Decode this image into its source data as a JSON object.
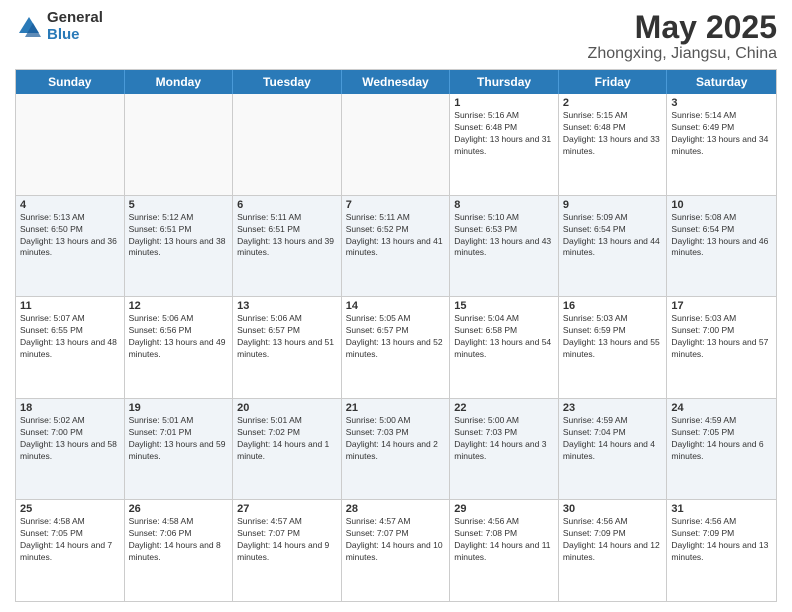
{
  "header": {
    "logo_general": "General",
    "logo_blue": "Blue",
    "title": "May 2025",
    "subtitle": "Zhongxing, Jiangsu, China"
  },
  "calendar": {
    "days": [
      "Sunday",
      "Monday",
      "Tuesday",
      "Wednesday",
      "Thursday",
      "Friday",
      "Saturday"
    ],
    "rows": [
      [
        {
          "num": "",
          "info": "",
          "empty": true
        },
        {
          "num": "",
          "info": "",
          "empty": true
        },
        {
          "num": "",
          "info": "",
          "empty": true
        },
        {
          "num": "",
          "info": "",
          "empty": true
        },
        {
          "num": "1",
          "info": "Sunrise: 5:16 AM\nSunset: 6:48 PM\nDaylight: 13 hours and 31 minutes."
        },
        {
          "num": "2",
          "info": "Sunrise: 5:15 AM\nSunset: 6:48 PM\nDaylight: 13 hours and 33 minutes."
        },
        {
          "num": "3",
          "info": "Sunrise: 5:14 AM\nSunset: 6:49 PM\nDaylight: 13 hours and 34 minutes."
        }
      ],
      [
        {
          "num": "4",
          "info": "Sunrise: 5:13 AM\nSunset: 6:50 PM\nDaylight: 13 hours and 36 minutes."
        },
        {
          "num": "5",
          "info": "Sunrise: 5:12 AM\nSunset: 6:51 PM\nDaylight: 13 hours and 38 minutes."
        },
        {
          "num": "6",
          "info": "Sunrise: 5:11 AM\nSunset: 6:51 PM\nDaylight: 13 hours and 39 minutes."
        },
        {
          "num": "7",
          "info": "Sunrise: 5:11 AM\nSunset: 6:52 PM\nDaylight: 13 hours and 41 minutes."
        },
        {
          "num": "8",
          "info": "Sunrise: 5:10 AM\nSunset: 6:53 PM\nDaylight: 13 hours and 43 minutes."
        },
        {
          "num": "9",
          "info": "Sunrise: 5:09 AM\nSunset: 6:54 PM\nDaylight: 13 hours and 44 minutes."
        },
        {
          "num": "10",
          "info": "Sunrise: 5:08 AM\nSunset: 6:54 PM\nDaylight: 13 hours and 46 minutes."
        }
      ],
      [
        {
          "num": "11",
          "info": "Sunrise: 5:07 AM\nSunset: 6:55 PM\nDaylight: 13 hours and 48 minutes."
        },
        {
          "num": "12",
          "info": "Sunrise: 5:06 AM\nSunset: 6:56 PM\nDaylight: 13 hours and 49 minutes."
        },
        {
          "num": "13",
          "info": "Sunrise: 5:06 AM\nSunset: 6:57 PM\nDaylight: 13 hours and 51 minutes."
        },
        {
          "num": "14",
          "info": "Sunrise: 5:05 AM\nSunset: 6:57 PM\nDaylight: 13 hours and 52 minutes."
        },
        {
          "num": "15",
          "info": "Sunrise: 5:04 AM\nSunset: 6:58 PM\nDaylight: 13 hours and 54 minutes."
        },
        {
          "num": "16",
          "info": "Sunrise: 5:03 AM\nSunset: 6:59 PM\nDaylight: 13 hours and 55 minutes."
        },
        {
          "num": "17",
          "info": "Sunrise: 5:03 AM\nSunset: 7:00 PM\nDaylight: 13 hours and 57 minutes."
        }
      ],
      [
        {
          "num": "18",
          "info": "Sunrise: 5:02 AM\nSunset: 7:00 PM\nDaylight: 13 hours and 58 minutes."
        },
        {
          "num": "19",
          "info": "Sunrise: 5:01 AM\nSunset: 7:01 PM\nDaylight: 13 hours and 59 minutes."
        },
        {
          "num": "20",
          "info": "Sunrise: 5:01 AM\nSunset: 7:02 PM\nDaylight: 14 hours and 1 minute."
        },
        {
          "num": "21",
          "info": "Sunrise: 5:00 AM\nSunset: 7:03 PM\nDaylight: 14 hours and 2 minutes."
        },
        {
          "num": "22",
          "info": "Sunrise: 5:00 AM\nSunset: 7:03 PM\nDaylight: 14 hours and 3 minutes."
        },
        {
          "num": "23",
          "info": "Sunrise: 4:59 AM\nSunset: 7:04 PM\nDaylight: 14 hours and 4 minutes."
        },
        {
          "num": "24",
          "info": "Sunrise: 4:59 AM\nSunset: 7:05 PM\nDaylight: 14 hours and 6 minutes."
        }
      ],
      [
        {
          "num": "25",
          "info": "Sunrise: 4:58 AM\nSunset: 7:05 PM\nDaylight: 14 hours and 7 minutes."
        },
        {
          "num": "26",
          "info": "Sunrise: 4:58 AM\nSunset: 7:06 PM\nDaylight: 14 hours and 8 minutes."
        },
        {
          "num": "27",
          "info": "Sunrise: 4:57 AM\nSunset: 7:07 PM\nDaylight: 14 hours and 9 minutes."
        },
        {
          "num": "28",
          "info": "Sunrise: 4:57 AM\nSunset: 7:07 PM\nDaylight: 14 hours and 10 minutes."
        },
        {
          "num": "29",
          "info": "Sunrise: 4:56 AM\nSunset: 7:08 PM\nDaylight: 14 hours and 11 minutes."
        },
        {
          "num": "30",
          "info": "Sunrise: 4:56 AM\nSunset: 7:09 PM\nDaylight: 14 hours and 12 minutes."
        },
        {
          "num": "31",
          "info": "Sunrise: 4:56 AM\nSunset: 7:09 PM\nDaylight: 14 hours and 13 minutes."
        }
      ]
    ]
  }
}
